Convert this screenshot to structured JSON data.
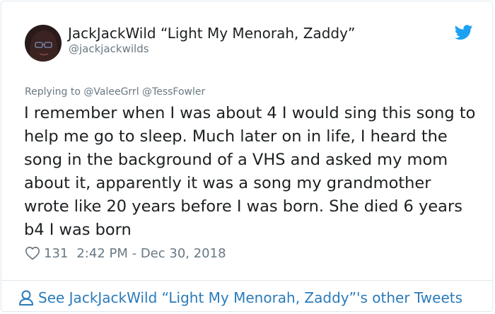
{
  "tweet": {
    "display_name": "JackJackWild “Light My Menorah, Zaddy”",
    "screen_name": "@jackjackwilds",
    "replying_prefix": "Replying to ",
    "mentions": [
      "@ValeeGrrl",
      "@TessFowler"
    ],
    "text": "I remember when I was about 4 I would sing this song to help me go to sleep. Much later on in life, I heard the song in the background of a VHS and asked my mom about it, apparently it was a song my grandmother wrote like 20 years before I was born. She died 6 years b4 I was born",
    "like_count": "131",
    "timestamp": "2:42 PM - Dec 30, 2018"
  },
  "footer": {
    "link_label": "See JackJackWild “Light My Menorah, Zaddy”'s other Tweets"
  },
  "icons": {
    "brand": "twitter-bird-icon",
    "like": "heart-icon",
    "profile": "person-icon"
  },
  "colors": {
    "text": "#1c2022",
    "secondary_text": "#697882",
    "link": "#2b7bb9",
    "twitter_blue": "#1da1f2",
    "border": "#e1e8ed"
  }
}
